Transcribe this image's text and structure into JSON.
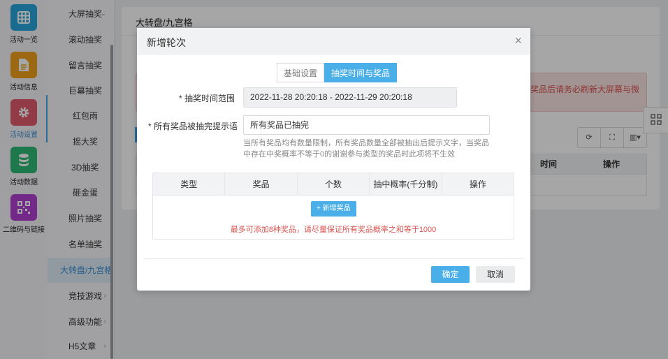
{
  "rail": {
    "items": [
      {
        "label": "活动一览",
        "icon": "grid-icon",
        "color": "#27a7dc"
      },
      {
        "label": "活动信息",
        "icon": "document-icon",
        "color": "#f0a21c"
      },
      {
        "label": "活动设置",
        "icon": "gear-icon",
        "color": "#e15a6b"
      },
      {
        "label": "活动数据",
        "icon": "database-icon",
        "color": "#2dba73"
      },
      {
        "label": "二维码与链接",
        "icon": "qrcode-icon",
        "color": "#b03fd0"
      }
    ]
  },
  "subnav": {
    "items": [
      {
        "label": "大屏抽奖",
        "caret": "⌄"
      },
      {
        "label": "滚动抽奖",
        "caret": ""
      },
      {
        "label": "留言抽奖",
        "caret": ""
      },
      {
        "label": "巨幕抽奖",
        "caret": ""
      },
      {
        "label": "红包雨",
        "caret": ""
      },
      {
        "label": "摇大奖",
        "caret": ""
      },
      {
        "label": "3D抽奖",
        "caret": ""
      },
      {
        "label": "砸金蛋",
        "caret": ""
      },
      {
        "label": "照片抽奖",
        "caret": ""
      },
      {
        "label": "名单抽奖",
        "caret": ""
      },
      {
        "label": "大转盘/九宫格",
        "caret": ""
      },
      {
        "label": "竞技游戏",
        "caret": "›"
      },
      {
        "label": "高级功能",
        "caret": "›"
      },
      {
        "label": "H5文章",
        "caret": "›"
      }
    ]
  },
  "main": {
    "title": "大转盘/九宫格",
    "alert_text": "或者奖品后请务必刷新大屏幕与微",
    "table_headers": {
      "time": "时间",
      "action": "操作"
    }
  },
  "modal": {
    "title": "新增轮次",
    "close": "×",
    "tabs": [
      {
        "label": "基础设置",
        "active": false
      },
      {
        "label": "抽奖时间与奖品",
        "active": true
      }
    ],
    "time_range_label": "* 抽奖时间范围",
    "time_range_value": "2022-11-28 20:20:18 - 2022-11-29 20:20:18",
    "tip_label": "* 所有奖品被抽完提示语",
    "tip_value": "所有奖品已抽完",
    "help_text": "当所有奖品均有数量限制，所有奖品数量全部被抽出后提示文字，当奖品中存在中奖概率不等于0的谢谢参与类型的奖品时此项将不生效",
    "prize_table": {
      "headers": [
        "类型",
        "奖品",
        "个数",
        "抽中概率(千分制)",
        "操作"
      ],
      "add_button": "+ 新增奖品",
      "note": "最多可添加8种奖品，请尽量保证所有奖品概率之和等于1000"
    },
    "ok": "确定",
    "cancel": "取消"
  },
  "colors": {
    "accent": "#4aaee9",
    "danger": "#d9534f"
  }
}
